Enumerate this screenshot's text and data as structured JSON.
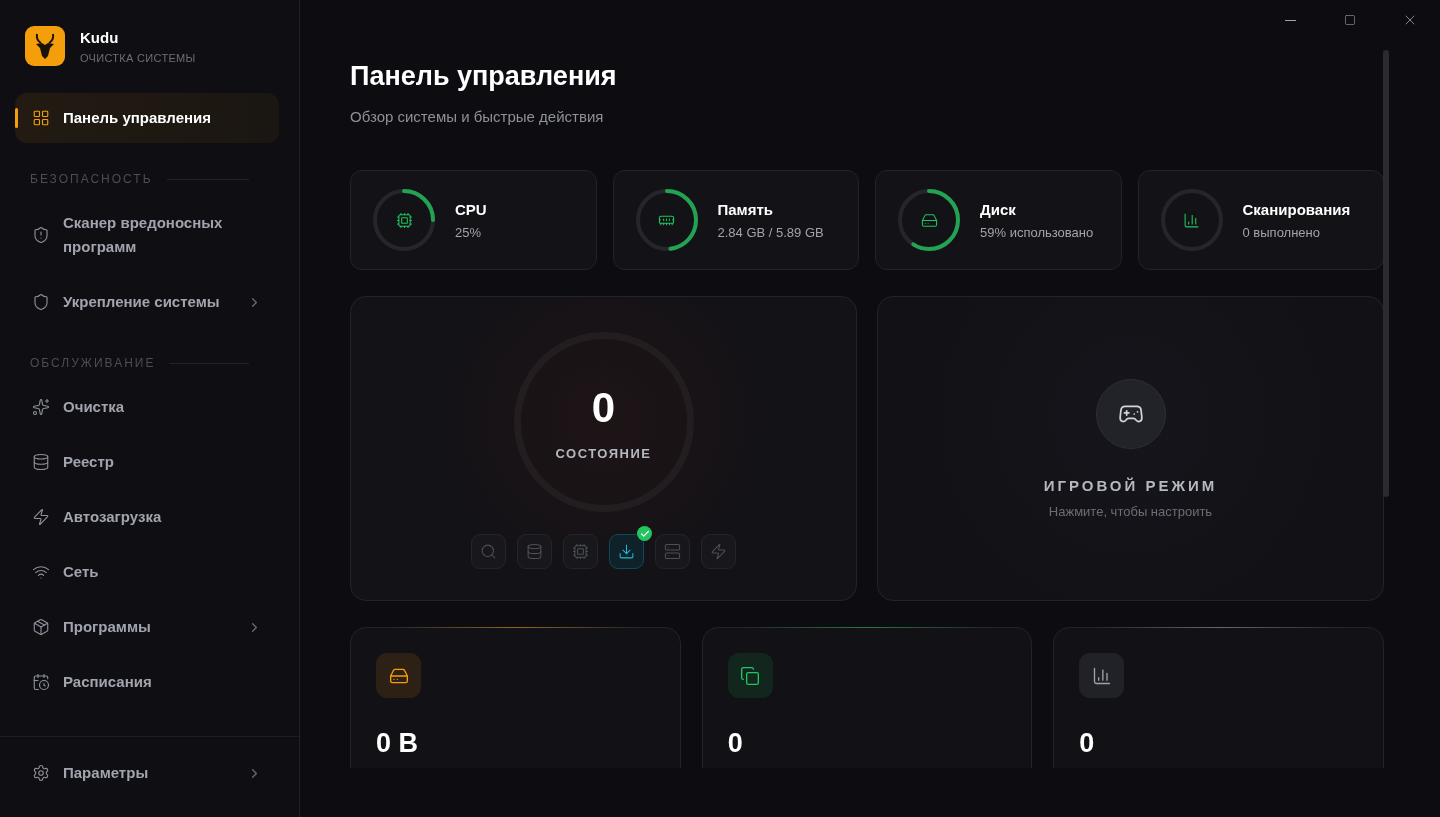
{
  "app": {
    "name": "Kudu",
    "subtitle": "ОЧИСТКА СИСТЕМЫ"
  },
  "sidebar": {
    "top_items": [
      {
        "label": "Панель управления",
        "selected": true,
        "has_submenu": false
      }
    ],
    "sections": [
      {
        "heading": "БЕЗОПАСНОСТЬ",
        "items": [
          {
            "label": "Сканер вредоносных программ",
            "selected": false,
            "has_submenu": false
          },
          {
            "label": "Укрепление системы",
            "selected": false,
            "has_submenu": true
          }
        ]
      },
      {
        "heading": "ОБСЛУЖИВАНИЕ",
        "items": [
          {
            "label": "Очистка",
            "selected": false,
            "has_submenu": false
          },
          {
            "label": "Реестр",
            "selected": false,
            "has_submenu": false
          },
          {
            "label": "Автозагрузка",
            "selected": false,
            "has_submenu": false
          },
          {
            "label": "Сеть",
            "selected": false,
            "has_submenu": false
          },
          {
            "label": "Программы",
            "selected": false,
            "has_submenu": true
          },
          {
            "label": "Расписания",
            "selected": false,
            "has_submenu": false
          }
        ]
      }
    ],
    "footer_item": {
      "label": "Параметры",
      "selected": false,
      "has_submenu": true
    }
  },
  "page": {
    "title": "Панель управления",
    "subtitle": "Обзор системы и быстрые действия"
  },
  "stats": [
    {
      "label": "CPU",
      "value": "25%"
    },
    {
      "label": "Память",
      "value": "2.84 GB / 5.89 GB"
    },
    {
      "label": "Диск",
      "value": "59% использовано"
    },
    {
      "label": "Сканирования",
      "value": "0 выполнено"
    }
  ],
  "status": {
    "score": "0",
    "label": "СОСТОЯНИЕ",
    "actions": [
      {
        "selected": false,
        "done": false
      },
      {
        "selected": false,
        "done": false
      },
      {
        "selected": false,
        "done": false
      },
      {
        "selected": true,
        "done": true
      },
      {
        "selected": false,
        "done": false
      },
      {
        "selected": false,
        "done": false
      }
    ]
  },
  "game_mode": {
    "title": "ИГРОВОЙ РЕЖИМ",
    "hint": "Нажмите, чтобы настроить"
  },
  "summary": [
    {
      "value": "0 B",
      "color": "#f59e0b"
    },
    {
      "value": "0",
      "color": "#22c55e"
    },
    {
      "value": "0",
      "color": "#9ca3af"
    }
  ]
}
